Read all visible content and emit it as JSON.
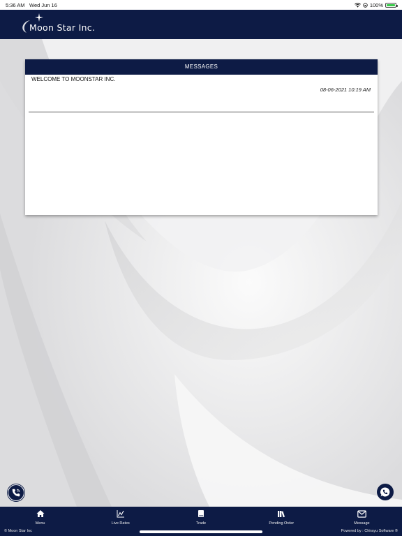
{
  "status_bar": {
    "time": "5:36 AM",
    "date": "Wed Jun 16",
    "battery": "100%",
    "battery_level": 1.0
  },
  "header": {
    "brand": "Moon Star Inc."
  },
  "messages_panel": {
    "title": "MESSAGES",
    "items": [
      {
        "text": "WELCOME TO MOONSTAR INC.",
        "timestamp": "08-06-2021 10:19 AM"
      }
    ]
  },
  "fabs": {
    "call_icon": "phone-call-icon",
    "whatsapp_icon": "whatsapp-icon"
  },
  "bottom_nav": {
    "items": [
      {
        "label": "Menu",
        "icon": "home-icon"
      },
      {
        "label": "Live Rates",
        "icon": "line-chart-icon"
      },
      {
        "label": "Trade",
        "icon": "book-icon"
      },
      {
        "label": "Pending Order",
        "icon": "books-icon"
      },
      {
        "label": "Message",
        "icon": "envelope-icon"
      }
    ]
  },
  "footer": {
    "left": "© Moon Star Inc",
    "right": "Powered by : Chirayu Software ®"
  },
  "colors": {
    "navy": "#0d1b45",
    "background": "#e9e9ea",
    "battery": "#38c94a"
  }
}
